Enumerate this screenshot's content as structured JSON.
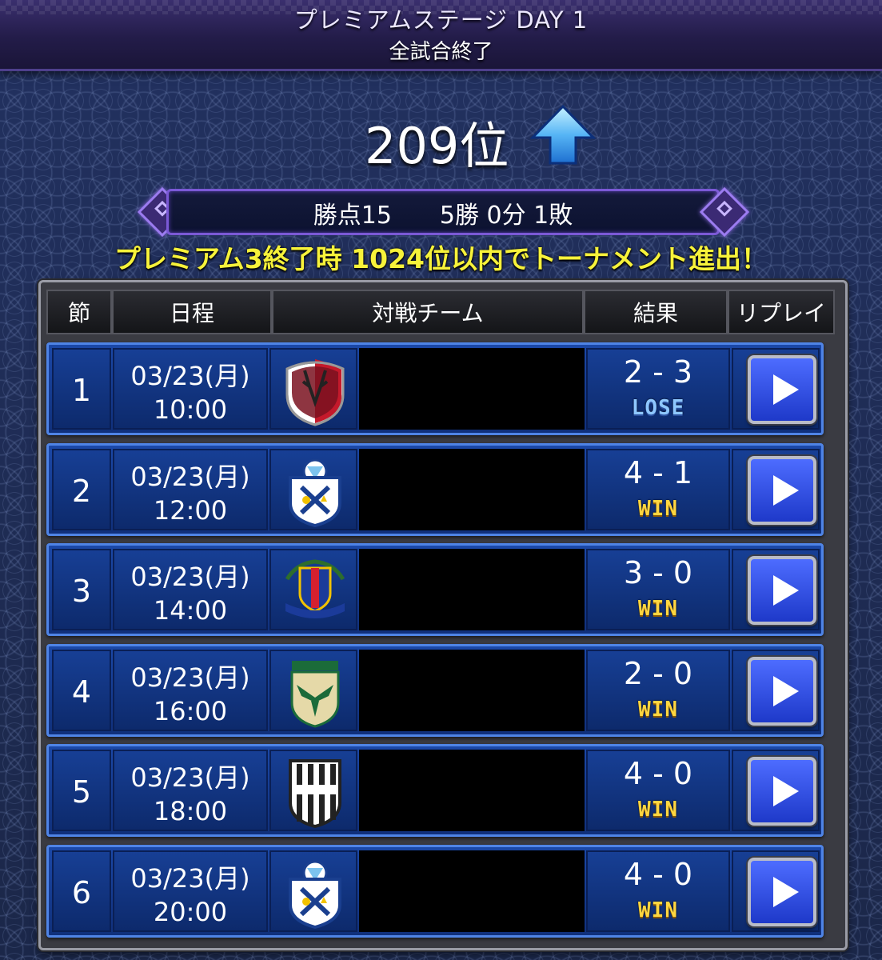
{
  "header": {
    "title": "プレミアムステージ DAY 1",
    "subtitle": "全試合終了"
  },
  "rank": {
    "text": "209位",
    "trend": "up-arrow-icon"
  },
  "summary": {
    "text": "勝点15　　5勝 0分 1敗"
  },
  "notice": "プレミアム3終了時 1024位以内でトーナメント進出！",
  "table": {
    "headers": {
      "round": "節",
      "schedule": "日程",
      "opponent": "対戦チーム",
      "result": "結果",
      "replay": "リプレイ"
    },
    "rows": [
      {
        "round": "1",
        "date": "03/23(月)",
        "time": "10:00",
        "crest": "kashima-antlers-crest-icon",
        "score": "2 - 3",
        "outcome": "LOSE"
      },
      {
        "round": "2",
        "date": "03/23(月)",
        "time": "12:00",
        "crest": "jubilo-iwata-crest-icon",
        "score": "4 - 1",
        "outcome": "WIN"
      },
      {
        "round": "3",
        "date": "03/23(月)",
        "time": "14:00",
        "crest": "yokohama-marinos-crest-icon",
        "score": "3 - 0",
        "outcome": "WIN"
      },
      {
        "round": "4",
        "date": "03/23(月)",
        "time": "16:00",
        "crest": "tokyo-verdy-crest-icon",
        "score": "2 - 0",
        "outcome": "WIN"
      },
      {
        "round": "5",
        "date": "03/23(月)",
        "time": "18:00",
        "crest": "vissel-kobe-crest-icon",
        "score": "4 - 0",
        "outcome": "WIN"
      },
      {
        "round": "6",
        "date": "03/23(月)",
        "time": "20:00",
        "crest": "jubilo-iwata-crest-icon",
        "score": "4 - 0",
        "outcome": "WIN"
      }
    ]
  },
  "colors": {
    "win": "#ffd640",
    "lose": "#8ec7ff",
    "notice": "#f7f23a",
    "accent": "#7b59d6"
  }
}
